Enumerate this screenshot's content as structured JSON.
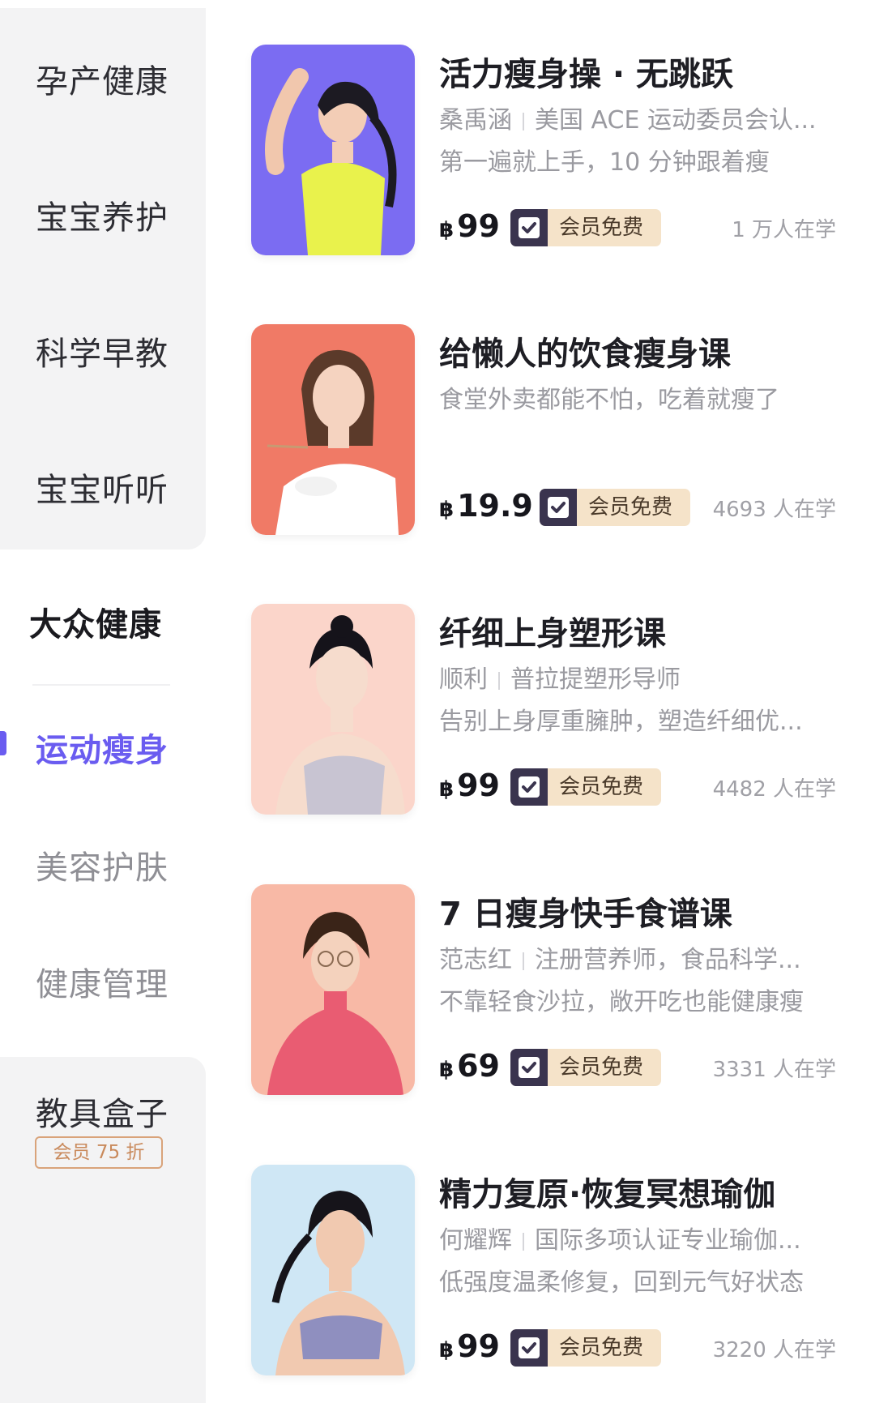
{
  "sidebar": {
    "items": [
      {
        "label": "孕产健康"
      },
      {
        "label": "宝宝养护"
      },
      {
        "label": "科学早教"
      },
      {
        "label": "宝宝听听"
      },
      {
        "label": "大众健康"
      },
      {
        "label": "运动瘦身"
      },
      {
        "label": "美容护肤"
      },
      {
        "label": "健康管理"
      },
      {
        "label": "教具盒子"
      }
    ],
    "active_index": 5,
    "active_color": "#6a5cf0",
    "toolbox_badge": "会员 75 折"
  },
  "courses": [
    {
      "title": "活力瘦身操 · 无跳跃",
      "teacher": "桑禹涵",
      "teacher_desc": "美国 ACE 运动委员会认...",
      "desc": "第一遍就上手，10 分钟跟着瘦",
      "currency": "฿",
      "price": "99",
      "member_label": "会员免费",
      "learners": "1 万人在学",
      "thumb_bg": "#7b6cf2"
    },
    {
      "title": "给懒人的饮食瘦身课",
      "desc": "食堂外卖都能不怕，吃着就瘦了",
      "currency": "฿",
      "price": "19.9",
      "member_label": "会员免费",
      "learners": "4693 人在学",
      "thumb_bg": "#f07a66"
    },
    {
      "title": "纤细上身塑形课",
      "teacher": "顺利",
      "teacher_desc": "普拉提塑形导师",
      "desc": "告别上身厚重臃肿，塑造纤细优...",
      "currency": "฿",
      "price": "99",
      "member_label": "会员免费",
      "learners": "4482 人在学",
      "thumb_bg": "#fbd5ca"
    },
    {
      "title": "7 日瘦身快手食谱课",
      "teacher": "范志红",
      "teacher_desc": "注册营养师，食品科学...",
      "desc": "不靠轻食沙拉，敞开吃也能健康瘦",
      "currency": "฿",
      "price": "69",
      "member_label": "会员免费",
      "learners": "3331 人在学",
      "thumb_bg": "#f8b9a6"
    },
    {
      "title": "精力复原·恢复冥想瑜伽",
      "teacher": "何耀辉",
      "teacher_desc": "国际多项认证专业瑜伽...",
      "desc": "低强度温柔修复，回到元气好状态",
      "currency": "฿",
      "price": "99",
      "member_label": "会员免费",
      "learners": "3220 人在学",
      "thumb_bg": "#cfe7f5"
    }
  ]
}
